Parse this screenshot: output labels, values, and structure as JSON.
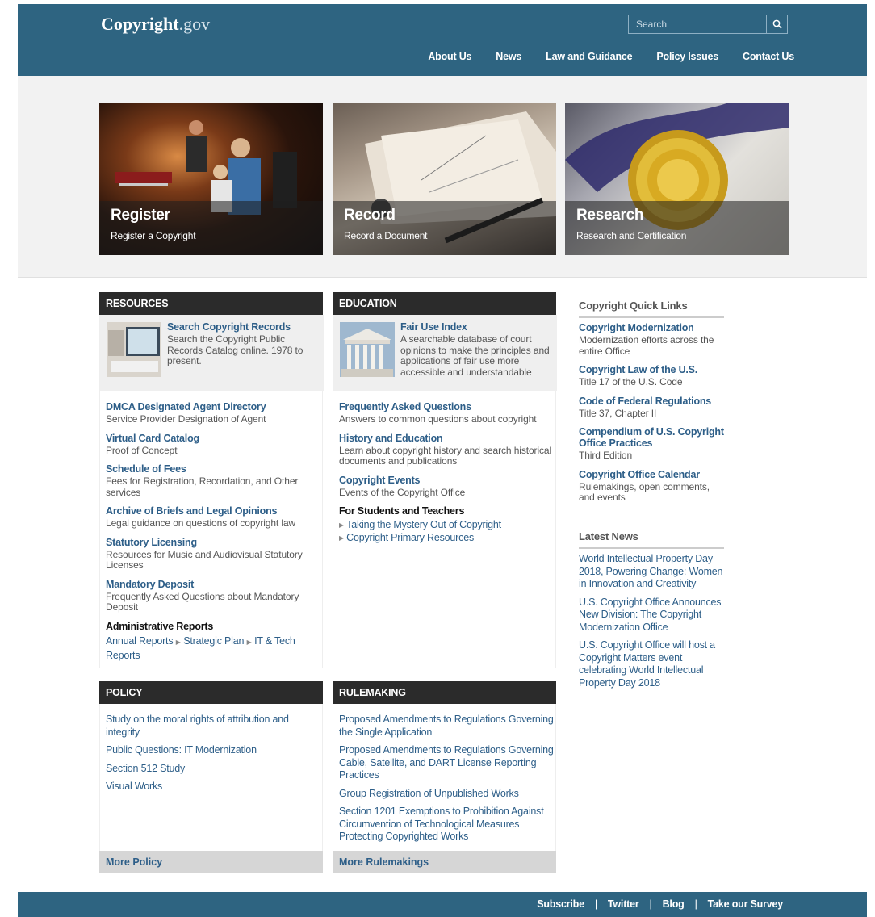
{
  "header": {
    "logo_main": "Copyright",
    "logo_suffix": ".gov",
    "search_placeholder": "Search",
    "nav": [
      "About Us",
      "News",
      "Law and Guidance",
      "Policy Issues",
      "Contact Us"
    ]
  },
  "tiles": [
    {
      "title": "Register",
      "subtitle": "Register a Copyright"
    },
    {
      "title": "Record",
      "subtitle": "Record a Document"
    },
    {
      "title": "Research",
      "subtitle": "Research and Certification"
    }
  ],
  "resources": {
    "heading": "RESOURCES",
    "feature_title": "Search Copyright Records",
    "feature_desc": "Search the Copyright Public Records Catalog online. 1978 to present.",
    "items": [
      {
        "title": "DMCA Designated Agent Directory",
        "desc": "Service Provider Designation of Agent"
      },
      {
        "title": "Virtual Card Catalog",
        "desc": "Proof of Concept"
      },
      {
        "title": "Schedule of Fees",
        "desc": "Fees for Registration, Recordation, and Other services"
      },
      {
        "title": "Archive of Briefs and Legal Opinions",
        "desc": "Legal guidance on questions of copyright law"
      },
      {
        "title": "Statutory Licensing",
        "desc": "Resources for Music and Audiovisual Statutory Licenses"
      },
      {
        "title": "Mandatory Deposit",
        "desc": "Frequently Asked Questions about Mandatory Deposit"
      }
    ],
    "admin_heading": "Administrative Reports",
    "admin_links": [
      "Annual Reports",
      "Strategic Plan",
      "IT & Tech Reports"
    ]
  },
  "education": {
    "heading": "EDUCATION",
    "feature_title": "Fair Use Index",
    "feature_desc": "A searchable database of court opinions to make the principles and applications of fair use more accessible and understandable",
    "items": [
      {
        "title": "Frequently Asked Questions",
        "desc": "Answers to common questions about copyright"
      },
      {
        "title": "History and Education",
        "desc": "Learn about copyright history and search historical documents and publications"
      },
      {
        "title": "Copyright Events",
        "desc": "Events of the Copyright Office"
      }
    ],
    "students_heading": "For Students and Teachers",
    "students_links": [
      "Taking the Mystery Out of Copyright",
      "Copyright Primary Resources"
    ]
  },
  "policy": {
    "heading": "POLICY",
    "items": [
      "Study on the moral rights of attribution and integrity",
      "Public Questions: IT Modernization",
      "Section 512 Study",
      "Visual Works"
    ],
    "more": "More Policy"
  },
  "rulemaking": {
    "heading": "RULEMAKING",
    "items": [
      "Proposed Amendments to Regulations Governing the Single Application",
      "Proposed Amendments to Regulations Governing Cable, Satellite, and DART License Reporting Practices",
      "Group Registration of Unpublished Works",
      "Section 1201 Exemptions to Prohibition Against Circumvention of Technological Measures Protecting Copyrighted Works"
    ],
    "more": "More Rulemakings"
  },
  "quick_links": {
    "heading": "Copyright Quick Links",
    "items": [
      {
        "title": "Copyright Modernization",
        "desc": "Modernization efforts across the entire Office"
      },
      {
        "title": "Copyright Law of the U.S.",
        "desc": "Title 17 of the U.S. Code"
      },
      {
        "title": "Code of Federal Regulations",
        "desc": "Title 37, Chapter II"
      },
      {
        "title": "Compendium of U.S. Copyright Office Practices",
        "desc": "Third Edition"
      },
      {
        "title": "Copyright Office Calendar",
        "desc": "Rulemakings, open comments, and events"
      }
    ]
  },
  "latest_news": {
    "heading": "Latest News",
    "items": [
      "World Intellectual Property Day 2018, Powering Change: Women in Innovation and Creativity",
      "U.S. Copyright Office Announces New Division: The Copyright Modernization Office",
      "U.S. Copyright Office will host a Copyright Matters event celebrating World Intellectual Property Day 2018"
    ]
  },
  "footer": {
    "links": [
      "Subscribe",
      "Twitter",
      "Blog",
      "Take our Survey"
    ],
    "separator": "|"
  }
}
